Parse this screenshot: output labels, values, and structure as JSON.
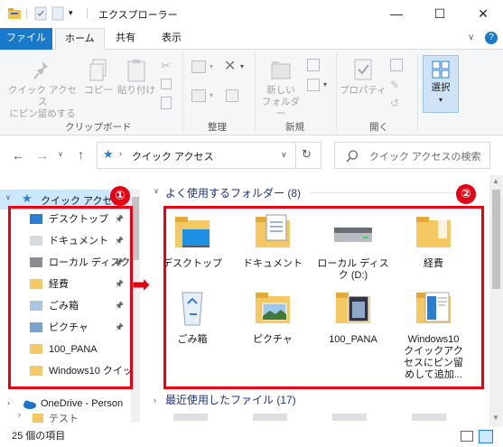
{
  "window": {
    "title": "エクスプローラー",
    "minimize": "—",
    "maximize": "☐",
    "close": "✕"
  },
  "ribbon_tabs": {
    "file": "ファイル",
    "home": "ホーム",
    "share": "共有",
    "view": "表示"
  },
  "ribbon": {
    "pin_quick_access": [
      "クイック アクセス",
      "にピン留めする"
    ],
    "copy": "コピー",
    "paste": "貼り付け",
    "new_folder": [
      "新しい",
      "フォルダー"
    ],
    "properties": "プロパティ",
    "select": "選択",
    "groups": {
      "clipboard": "クリップボード",
      "organize": "整理",
      "new": "新規",
      "open": "開く"
    }
  },
  "nav": {
    "path": "クイック アクセス",
    "search_placeholder": "クイック アクセスの検索"
  },
  "sidebar": {
    "quick_access": "クイック アクセス",
    "items": [
      {
        "label": "デスクトップ",
        "pinned": true
      },
      {
        "label": "ドキュメント",
        "pinned": true
      },
      {
        "label": "ローカル ディスク",
        "pinned": true
      },
      {
        "label": "経費",
        "pinned": true
      },
      {
        "label": "ごみ箱",
        "pinned": true
      },
      {
        "label": "ピクチャ",
        "pinned": true
      },
      {
        "label": "100_PANA",
        "pinned": false
      },
      {
        "label": "Windows10 クイッ",
        "pinned": false
      }
    ],
    "onedrive": "OneDrive - Person",
    "partial_item": "テスト"
  },
  "frequent": {
    "header": "よく使用するフォルダー (8)",
    "tiles": [
      {
        "label": "デスクトップ",
        "icon": "desktop-folder-icon"
      },
      {
        "label": "ドキュメント",
        "icon": "document-folder-icon"
      },
      {
        "label": "ローカル ディス\nク (D:)",
        "icon": "drive-icon"
      },
      {
        "label": "経費",
        "icon": "folder-icon"
      },
      {
        "label": "ごみ箱",
        "icon": "recycle-bin-icon"
      },
      {
        "label": "ピクチャ",
        "icon": "pictures-folder-icon"
      },
      {
        "label": "100_PANA",
        "icon": "photo-folder-icon"
      },
      {
        "label": "Windows10\nクイックアク\nセスにピン留\nめして追加...",
        "icon": "screenshot-folder-icon"
      }
    ]
  },
  "recent": {
    "header": "最近使用したファイル (17)"
  },
  "annotations": {
    "badge1": "①",
    "badge2": "②",
    "arrow": "➡"
  },
  "status": {
    "count": "25 個の項目"
  },
  "colors": {
    "accent": "#1979ca",
    "annotation_red": "#e60012",
    "section_header": "#1e3287"
  }
}
